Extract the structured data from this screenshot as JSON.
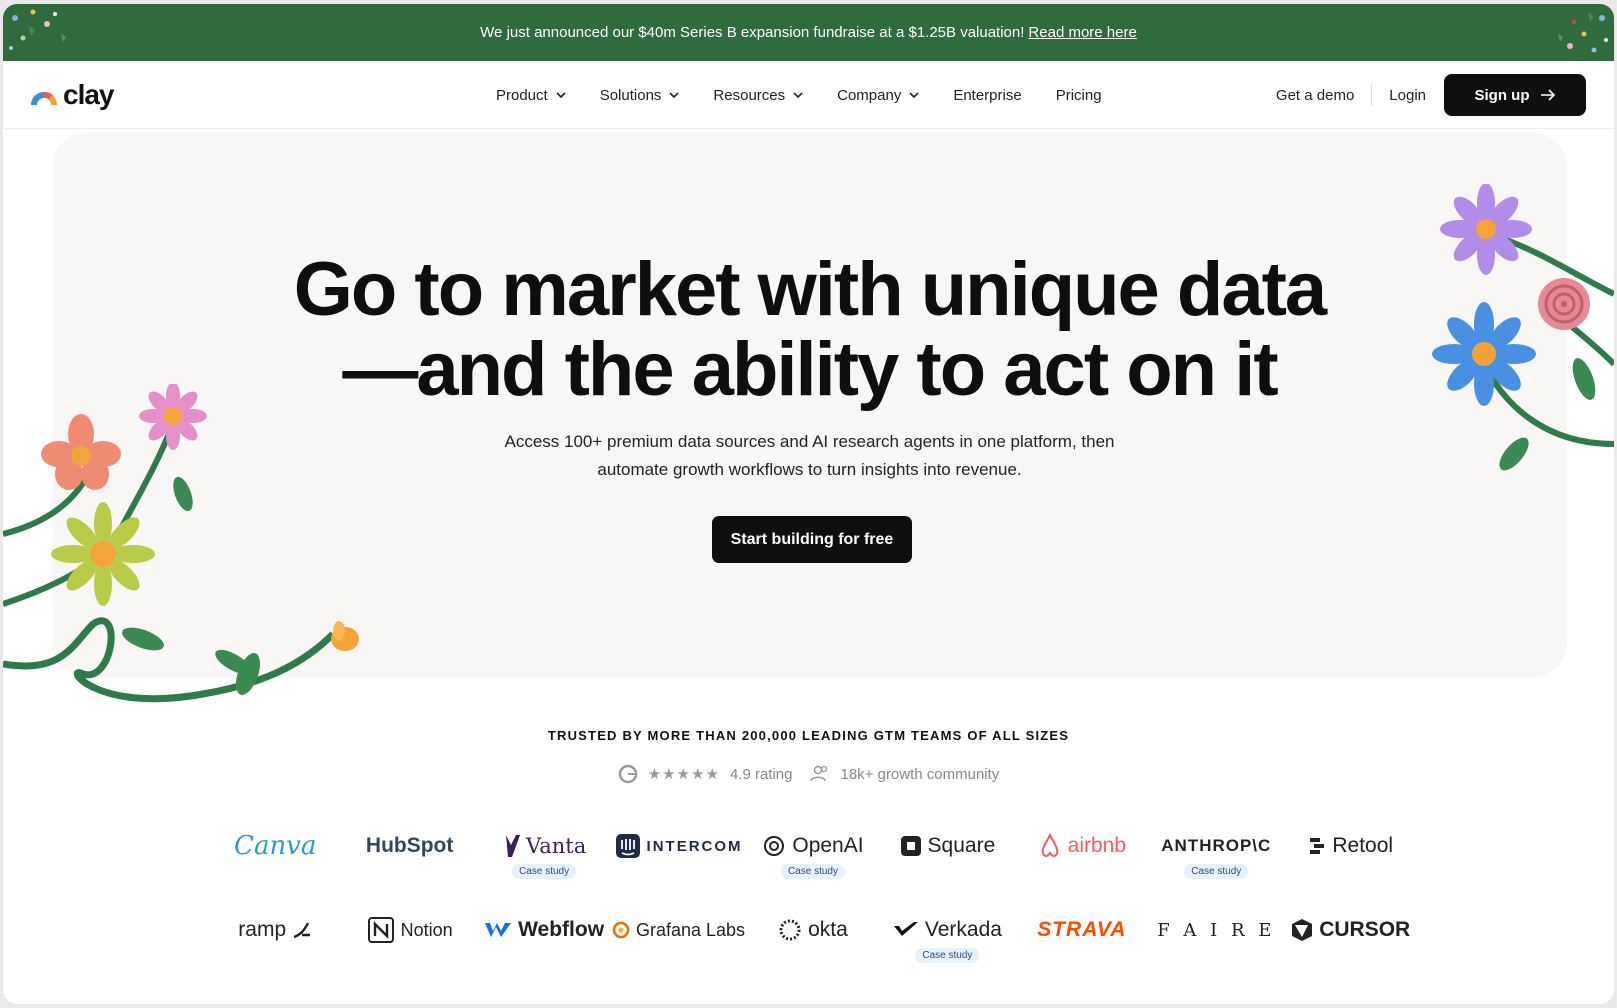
{
  "announcement": {
    "text": "We just announced our $40m Series B expansion fundraise at a $1.25B valuation!",
    "link": "Read more here"
  },
  "nav": {
    "logo": "clay",
    "links": [
      "Product",
      "Solutions",
      "Resources",
      "Company",
      "Enterprise",
      "Pricing"
    ],
    "get_demo": "Get a demo",
    "login": "Login",
    "signup": "Sign up"
  },
  "hero": {
    "headline_line1": "Go to market with unique data",
    "headline_line2": "—and the ability to act on it",
    "sub_line1": "Access 100+ premium data sources and AI research agents in one platform, then",
    "sub_line2": "automate growth workflows to turn insights into revenue.",
    "cta": "Start building for free"
  },
  "trust": {
    "title": "TRUSTED BY MORE THAN 200,000 LEADING GTM TEAMS OF ALL SIZES",
    "rating": "4.9 rating",
    "community": "18k+ growth community",
    "stars": "★★★★★"
  },
  "logos_row1": [
    {
      "name": "Canva",
      "case": ""
    },
    {
      "name": "HubSpot",
      "case": ""
    },
    {
      "name": "Vanta",
      "case": "Case study"
    },
    {
      "name": "INTERCOM",
      "case": ""
    },
    {
      "name": "OpenAI",
      "case": "Case study"
    },
    {
      "name": "Square",
      "case": ""
    },
    {
      "name": "airbnb",
      "case": ""
    },
    {
      "name": "ANTHROP\\C",
      "case": "Case study"
    },
    {
      "name": "Retool",
      "case": ""
    }
  ],
  "logos_row2": [
    {
      "name": "ramp",
      "case": ""
    },
    {
      "name": "Notion",
      "case": ""
    },
    {
      "name": "Webflow",
      "case": ""
    },
    {
      "name": "Grafana Labs",
      "case": ""
    },
    {
      "name": "okta",
      "case": ""
    },
    {
      "name": "Verkada",
      "case": "Case study"
    },
    {
      "name": "STRAVA",
      "case": ""
    },
    {
      "name": "F A I R E",
      "case": ""
    },
    {
      "name": "CURSOR",
      "case": ""
    }
  ],
  "colors": {
    "announcement_bg": "#2f6b3c",
    "primary_button": "#0f0f0f",
    "hero_bg": "#f8f7f5"
  }
}
